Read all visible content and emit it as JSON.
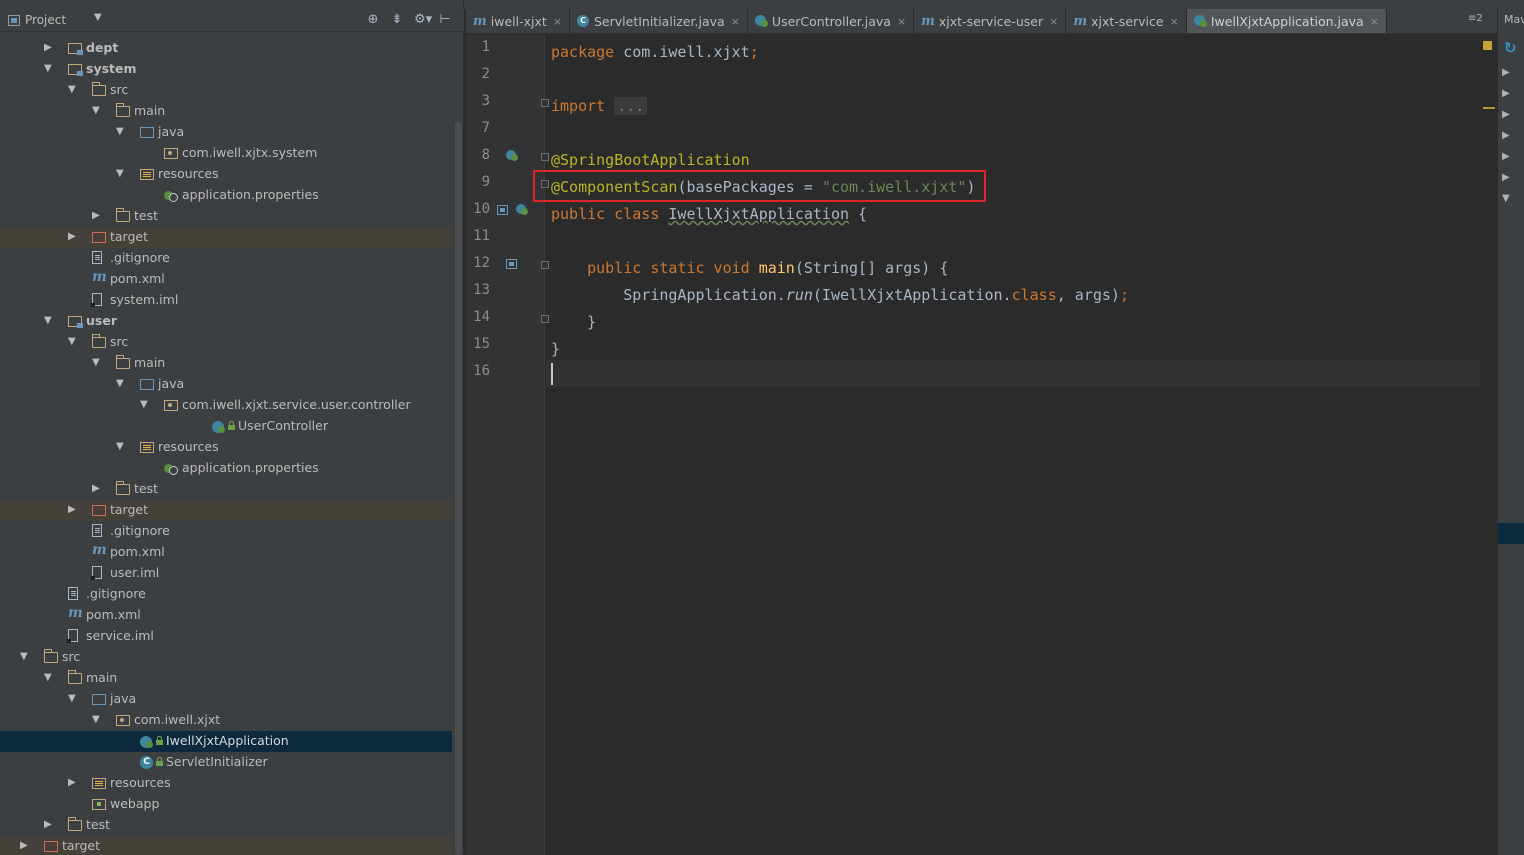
{
  "project_panel": {
    "title": "Project",
    "dropdown": "▼",
    "tools": [
      "⊕",
      "⇟",
      "⚙▾",
      "⊢"
    ],
    "tree": [
      {
        "label": "dept",
        "icon": "module-folder-icon",
        "depth": 2,
        "arrow": "right",
        "bold": true
      },
      {
        "label": "system",
        "icon": "module-folder-icon",
        "depth": 2,
        "arrow": "down",
        "bold": true
      },
      {
        "label": "src",
        "icon": "folder-icon",
        "depth": 3,
        "arrow": "down"
      },
      {
        "label": "main",
        "icon": "folder-icon",
        "depth": 4,
        "arrow": "down"
      },
      {
        "label": "java",
        "icon": "source-folder-icon",
        "depth": 5,
        "arrow": "down"
      },
      {
        "label": "com.iwell.xjtx.system",
        "icon": "package-icon",
        "depth": 6
      },
      {
        "label": "resources",
        "icon": "resources-folder-icon",
        "depth": 5,
        "arrow": "down"
      },
      {
        "label": "application.properties",
        "icon": "spring-properties-icon",
        "depth": 6
      },
      {
        "label": "test",
        "icon": "folder-icon",
        "depth": 4,
        "arrow": "right"
      },
      {
        "label": "target",
        "icon": "excluded-folder-icon",
        "depth": 3,
        "arrow": "right",
        "excluded": true
      },
      {
        "label": ".gitignore",
        "icon": "text-file-icon",
        "depth": 3
      },
      {
        "label": "pom.xml",
        "icon": "maven-icon",
        "depth": 3
      },
      {
        "label": "system.iml",
        "icon": "iml-file-icon",
        "depth": 3
      },
      {
        "label": "user",
        "icon": "module-folder-icon",
        "depth": 2,
        "arrow": "down",
        "bold": true
      },
      {
        "label": "src",
        "icon": "folder-icon",
        "depth": 3,
        "arrow": "down"
      },
      {
        "label": "main",
        "icon": "folder-icon",
        "depth": 4,
        "arrow": "down"
      },
      {
        "label": "java",
        "icon": "source-folder-icon",
        "depth": 5,
        "arrow": "down"
      },
      {
        "label": "com.iwell.xjxt.service.user.controller",
        "icon": "package-icon",
        "depth": 6,
        "arrow": "down"
      },
      {
        "label": "UserController",
        "icon": "spring-class-icon",
        "depth": 8,
        "lock": true
      },
      {
        "label": "resources",
        "icon": "resources-folder-icon",
        "depth": 5,
        "arrow": "down"
      },
      {
        "label": "application.properties",
        "icon": "spring-properties-icon",
        "depth": 6
      },
      {
        "label": "test",
        "icon": "folder-icon",
        "depth": 4,
        "arrow": "right"
      },
      {
        "label": "target",
        "icon": "excluded-folder-icon",
        "depth": 3,
        "arrow": "right",
        "excluded": true
      },
      {
        "label": ".gitignore",
        "icon": "text-file-icon",
        "depth": 3
      },
      {
        "label": "pom.xml",
        "icon": "maven-icon",
        "depth": 3
      },
      {
        "label": "user.iml",
        "icon": "iml-file-icon",
        "depth": 3
      },
      {
        "label": ".gitignore",
        "icon": "text-file-icon",
        "depth": 2
      },
      {
        "label": "pom.xml",
        "icon": "maven-icon",
        "depth": 2
      },
      {
        "label": "service.iml",
        "icon": "iml-file-icon",
        "depth": 2
      },
      {
        "label": "src",
        "icon": "folder-icon",
        "depth": 1,
        "arrow": "down"
      },
      {
        "label": "main",
        "icon": "folder-icon",
        "depth": 2,
        "arrow": "down"
      },
      {
        "label": "java",
        "icon": "source-folder-icon",
        "depth": 3,
        "arrow": "down"
      },
      {
        "label": "com.iwell.xjxt",
        "icon": "package-icon",
        "depth": 4,
        "arrow": "down"
      },
      {
        "label": "IwellXjxtApplication",
        "icon": "spring-class-icon",
        "depth": 5,
        "lock": true,
        "selected": true
      },
      {
        "label": "ServletInitializer",
        "icon": "class-icon",
        "depth": 5,
        "lock": true
      },
      {
        "label": "resources",
        "icon": "resources-folder-icon",
        "depth": 3,
        "arrow": "right"
      },
      {
        "label": "webapp",
        "icon": "web-folder-icon",
        "depth": 3
      },
      {
        "label": "test",
        "icon": "folder-icon",
        "depth": 2,
        "arrow": "right"
      },
      {
        "label": "target",
        "icon": "excluded-folder-icon",
        "depth": 1,
        "arrow": "right",
        "excluded": true
      }
    ]
  },
  "editor_tabs": [
    {
      "label": "iwell-xjxt",
      "icon": "m"
    },
    {
      "label": "ServletInitializer.java",
      "icon": "c"
    },
    {
      "label": "UserController.java",
      "icon": "s"
    },
    {
      "label": "xjxt-service-user",
      "icon": "m"
    },
    {
      "label": "xjxt-service",
      "icon": "m"
    },
    {
      "label": "IwellXjxtApplication.java",
      "icon": "s",
      "active": true
    }
  ],
  "tabs_more": "≡2",
  "editor": {
    "line_numbers": [
      "1",
      "2",
      "3",
      "7",
      "8",
      "9",
      "10",
      "11",
      "12",
      "13",
      "14",
      "15",
      "16"
    ],
    "code": {
      "l1_kw": "package",
      "l1_rest": " com.iwell.xjxt",
      "l1_semi": ";",
      "l3_kw": "import",
      "l3_fold": "...",
      "l8_ann": "@SpringBootApplication",
      "l9_ann": "@ComponentScan",
      "l9_mid": "(basePackages = ",
      "l9_str": "\"com.iwell.xjxt\"",
      "l9_end": ")",
      "l10_kw": "public class",
      "l10_name": "IwellXjxtApplication",
      "l10_end": " {",
      "l12_kw": "public static void",
      "l12_name": "main",
      "l12_args": "(String[] args) {",
      "l13_a": "SpringApplication.",
      "l13_run": "run",
      "l13_b": "(IwellXjxtApplication.",
      "l13_class": "class",
      "l13_c": ", args)",
      "l13_semi": ";",
      "l14": "}",
      "l15": "}"
    }
  },
  "right_panel": {
    "label": "Mav"
  }
}
